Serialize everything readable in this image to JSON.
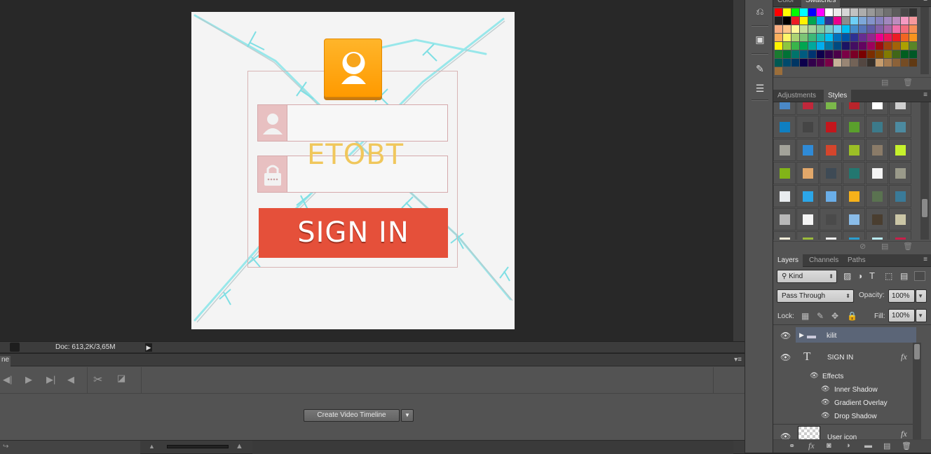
{
  "document": {
    "watermark": "ETOBT",
    "signin_label": "SIGN IN"
  },
  "status_bar": {
    "doc_info": "Doc: 613,2K/3,65M"
  },
  "timeline": {
    "tab_title": "ne",
    "create_button_label": "Create Video Timeline"
  },
  "color_panel": {
    "tabs": [
      "Color",
      "Swatches"
    ],
    "active_tab": "Swatches",
    "swatches": [
      "#ff0000",
      "#ffff00",
      "#00ff00",
      "#00ffff",
      "#0000ff",
      "#ff00ff",
      "#ffffff",
      "#ebebeb",
      "#d6d6d6",
      "#c2c2c2",
      "#adadad",
      "#999999",
      "#858585",
      "#707070",
      "#5c5c5c",
      "#474747",
      "#333333",
      "#1f1f1f",
      "#000000",
      "#ed1c24",
      "#fff200",
      "#00a651",
      "#00aeef",
      "#2e3192",
      "#ec008c",
      "#8c8c8c",
      "#6dcff6",
      "#7da7d9",
      "#8393ca",
      "#8781bd",
      "#a187be",
      "#bd8cbf",
      "#f49ac2",
      "#f6989d",
      "#f9ad81",
      "#fdc68a",
      "#fff79a",
      "#c4df9b",
      "#a3d39c",
      "#82ca9d",
      "#7accc8",
      "#6dcff6",
      "#00bff3",
      "#448ccb",
      "#5574b9",
      "#605ca8",
      "#8560a8",
      "#a864a8",
      "#f06eaa",
      "#f26c7d",
      "#f68e56",
      "#fbaf5d",
      "#fff568",
      "#acd373",
      "#7cc576",
      "#3cb878",
      "#1abbb4",
      "#00bff3",
      "#0072bc",
      "#0054a6",
      "#2e3192",
      "#662d91",
      "#92278f",
      "#ec008c",
      "#ed145b",
      "#ed1c24",
      "#f26522",
      "#f7941d",
      "#fff200",
      "#8dc63f",
      "#39b54a",
      "#00a651",
      "#00a99d",
      "#00aeef",
      "#0076a3",
      "#004a80",
      "#1b1464",
      "#440e62",
      "#630460",
      "#9e005d",
      "#9e0b0f",
      "#a0410d",
      "#a36209",
      "#aba000",
      "#598527",
      "#1a7b30",
      "#007236",
      "#00746b",
      "#005b7f",
      "#003471",
      "#0d004c",
      "#32004b",
      "#4b0049",
      "#7b0046",
      "#7a0026",
      "#790000",
      "#7b2e00",
      "#7d4900",
      "#827b00",
      "#406618",
      "#005e20",
      "#005826",
      "#005952",
      "#004a6c",
      "#003663",
      "#0c004b",
      "#32004b",
      "#4b0049",
      "#7b0046",
      "#c7b299",
      "#998675",
      "#736357",
      "#534741",
      "#37302a",
      "#c69c6d",
      "#a67c52",
      "#8c6239",
      "#754c24",
      "#603913",
      "#9b6e3a"
    ]
  },
  "styles_panel": {
    "tabs": [
      "Adjustments",
      "Styles"
    ],
    "active_tab": "Styles",
    "styles": [
      "#4a88c7",
      "#c0283b",
      "#7bb84a",
      "#b8242b",
      "#ffffff",
      "#cfcfcf",
      "#0f7fc1",
      "#454545",
      "#c4161c",
      "#5aa02c",
      "#3c7a8a",
      "#4c8aa0",
      "#a3a39a",
      "#2f8ad6",
      "#d4452c",
      "#9cbf26",
      "#8a7b68",
      "#c6f22c",
      "#82b418",
      "#e2a86a",
      "#3e4a55",
      "#237770",
      "#f4f4f4",
      "#9a9a8a",
      "#e8ecef",
      "#2ba6e8",
      "#6aaee8",
      "#f7b21a",
      "#5a7250",
      "#3a7a98",
      "#b8b8b8",
      "#f4f4f4",
      "#4a4a4a",
      "#8abce8",
      "#4a3e30",
      "#cbc6a6",
      "#f2ecd8",
      "#9bbb3a",
      "#f4f4f4",
      "#2a9ed0",
      "#b8eaf2",
      "#c8204a"
    ]
  },
  "layers_panel": {
    "tabs": [
      "Layers",
      "Channels",
      "Paths"
    ],
    "active_tab": "Layers",
    "kind_label": "Kind",
    "blend_mode": "Pass Through",
    "opacity_label": "Opacity:",
    "opacity_value": "100%",
    "lock_label": "Lock:",
    "fill_label": "Fill:",
    "fill_value": "100%",
    "layers": {
      "group_name": "kilit",
      "text_layer_name": "SIGN IN",
      "effects_label": "Effects",
      "effect_1": "Inner Shadow",
      "effect_2": "Gradient Overlay",
      "effect_3": "Drop Shadow",
      "next_layer_name": "User icon"
    }
  }
}
